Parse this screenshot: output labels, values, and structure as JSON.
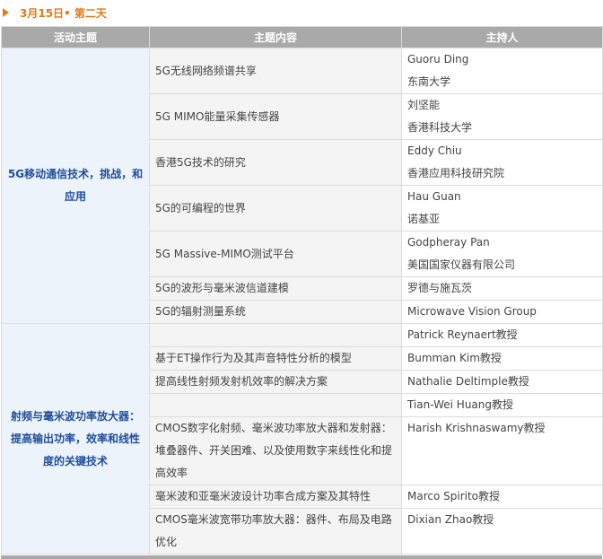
{
  "day_title": "3月15日• 第二天",
  "columns": {
    "theme": "活动主题",
    "topic": "主题内容",
    "host": "主持人"
  },
  "colors": {
    "accent": "#e07a1a",
    "header_bg": "#a9a9a9",
    "theme_text": "#1f4f9b"
  },
  "sessions": [
    {
      "theme": "5G移动通信技术，挑战，和应用",
      "rows": [
        {
          "topic": "5G无线网络频谱共享",
          "host_name": "Guoru Ding",
          "host_org": "东南大学"
        },
        {
          "topic": "5G MIMO能量采集传感器",
          "host_name": "刘坚能",
          "host_org": "香港科技大学"
        },
        {
          "topic": "香港5G技术的研究",
          "host_name": "Eddy Chiu",
          "host_org": "香港应用科技研究院"
        },
        {
          "topic": "5G的可编程的世界",
          "host_name": "Hau Guan",
          "host_org": "诺基亚"
        },
        {
          "topic": "5G  Massive-MIMO测试平台",
          "host_name": "Godpheray  Pan",
          "host_org": "美国国家仪器有限公司"
        },
        {
          "topic": "5G的波形与毫米波信道建模",
          "host_name": "罗德与施瓦茨"
        },
        {
          "topic": "5G的辐射测量系统",
          "host_name": "Microwave Vision Group"
        }
      ]
    },
    {
      "theme": "射频与毫米波功率放大器：提高输出功率，效率和线性度的关键技术",
      "rows": [
        {
          "topic": "",
          "host_name": "Patrick  Reynaert教授"
        },
        {
          "topic": "基于ET操作行为及其声音特性分析的模型",
          "host_name": "Bumman Kim教授"
        },
        {
          "topic": "提高线性射频发射机效率的解决方案",
          "host_name": "Nathalie  Deltimple教授"
        },
        {
          "topic": "",
          "host_name": "Tian-Wei Huang教授"
        },
        {
          "topic": "CMOS数字化射频、毫米波功率放大器和发射器：堆叠器件、开关困难、以及使用数字来线性化和提高效率",
          "host_name": "Harish  Krishnaswamy教授"
        },
        {
          "topic": "毫米波和亚毫米波设计功率合成方案及其特性",
          "host_name": "Marco Spirito教授"
        },
        {
          "topic": "CMOS毫米波宽带功率放大器：器件、布局及电路优化",
          "host_name": "Dixian  Zhao教授"
        }
      ]
    }
  ]
}
